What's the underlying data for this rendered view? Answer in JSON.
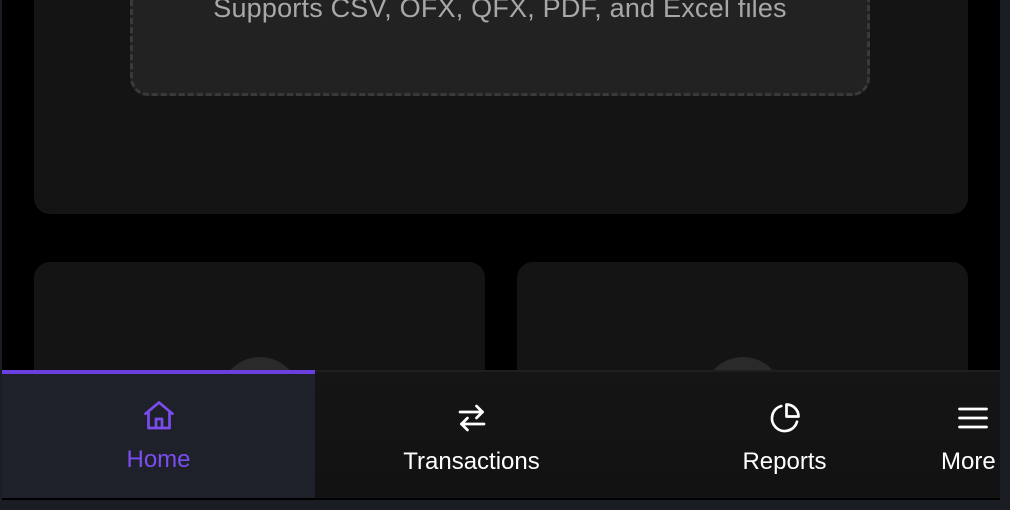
{
  "import": {
    "dropzone_hint": "Supports CSV, OFX, QFX, PDF, and Excel files"
  },
  "bottom_nav": {
    "active_color": "#7b4df0",
    "items": [
      {
        "label": "Home",
        "icon": "home-icon",
        "active": true
      },
      {
        "label": "Transactions",
        "icon": "arrows-swap-icon",
        "active": false
      },
      {
        "label": "Reports",
        "icon": "pie-chart-icon",
        "active": false
      },
      {
        "label": "More",
        "icon": "menu-icon",
        "active": false
      }
    ]
  }
}
